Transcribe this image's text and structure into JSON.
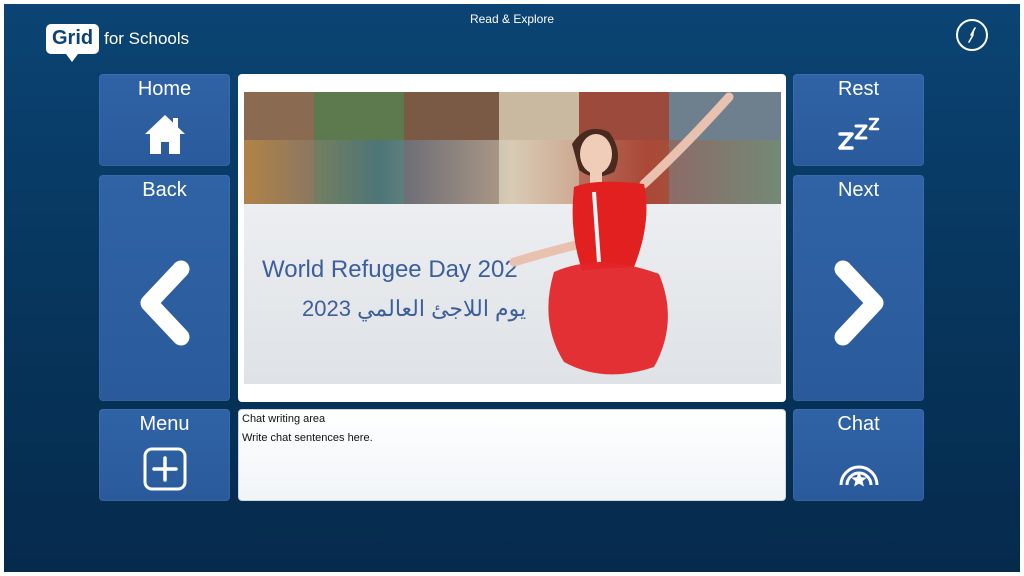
{
  "header": {
    "logo_main": "Grid",
    "logo_suffix": "for Schools",
    "title": "Read & Explore",
    "compass_icon": "compass-icon"
  },
  "cells": {
    "home": {
      "label": "Home",
      "icon": "home-icon"
    },
    "back": {
      "label": "Back",
      "icon": "chevron-left-icon"
    },
    "menu": {
      "label": "Menu",
      "icon": "plus-square-icon"
    },
    "rest": {
      "label": "Rest",
      "icon": "zzz-icon"
    },
    "next": {
      "label": "Next",
      "icon": "chevron-right-icon"
    },
    "chat": {
      "label": "Chat",
      "icon": "chat-star-icon"
    }
  },
  "photo": {
    "banner_text_en": "World Refugee Day 202",
    "banner_text_ar": "يوم اللاجئ العالمي 2023"
  },
  "chat_area": {
    "label": "Chat writing area",
    "text": "Write chat sentences here."
  },
  "colors": {
    "background": "#07375f",
    "cell": "#2f63a6",
    "dress": "#e32020"
  }
}
